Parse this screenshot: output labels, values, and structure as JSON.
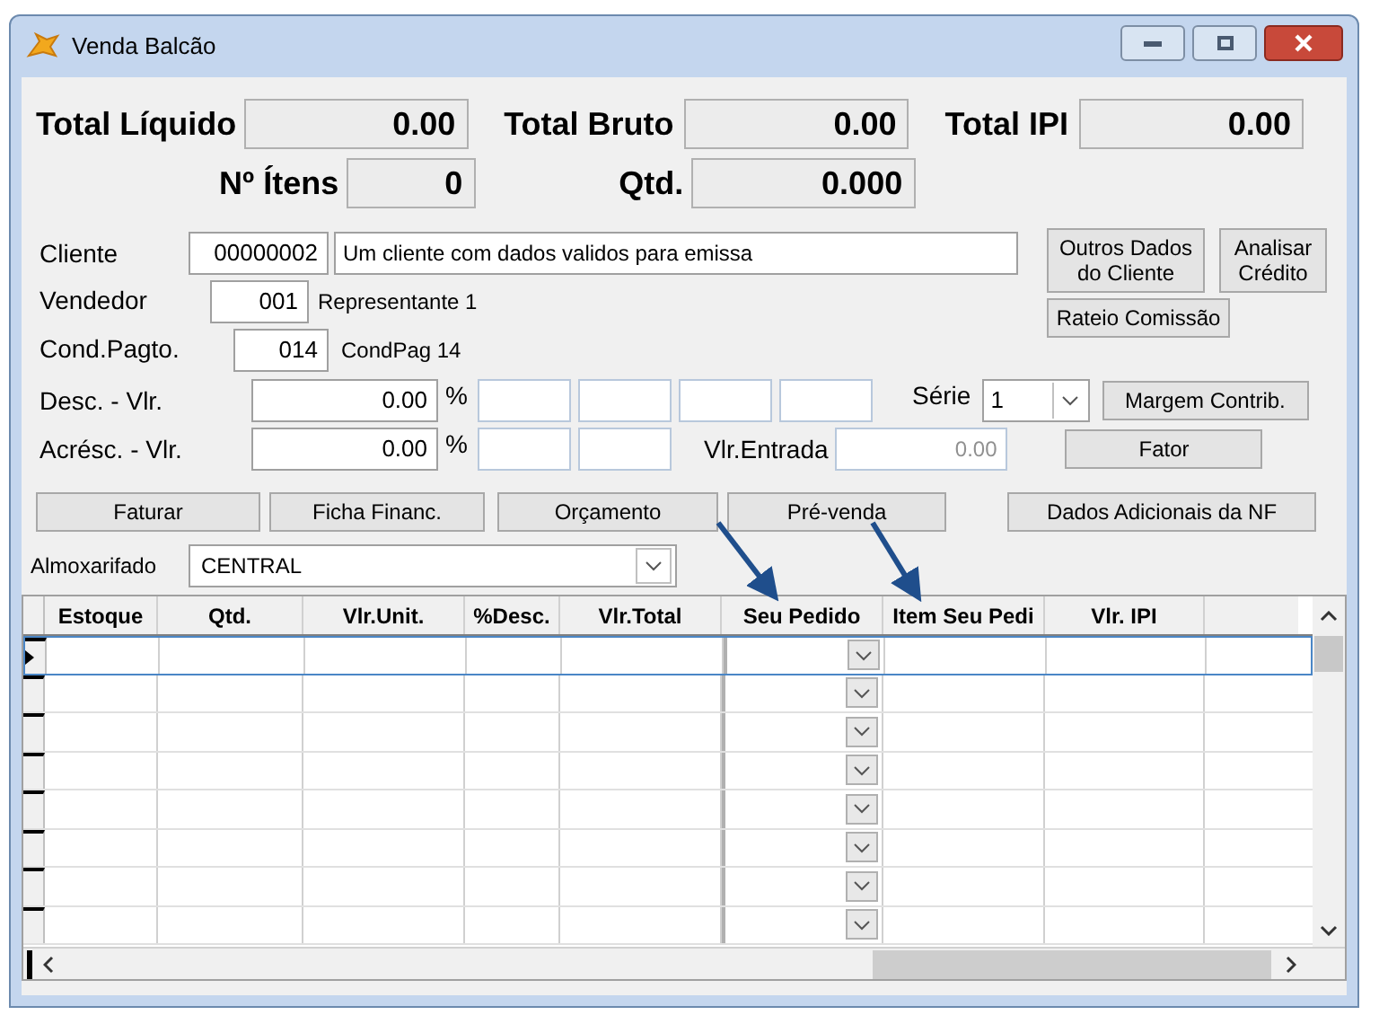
{
  "window": {
    "title": "Venda Balcão"
  },
  "totals": [
    {
      "label": "Total Líquido",
      "value": "0.00"
    },
    {
      "label": "Total Bruto",
      "value": "0.00"
    },
    {
      "label": "Total IPI",
      "value": "0.00"
    }
  ],
  "counts": [
    {
      "label": "Nº Ítens",
      "value": "0"
    },
    {
      "label": "Qtd.",
      "value": "0.000"
    }
  ],
  "cliente": {
    "label": "Cliente",
    "code": "00000002",
    "name": "Um cliente com dados validos para emissa"
  },
  "vendedor": {
    "label": "Vendedor",
    "code": "001",
    "name": "Representante 1"
  },
  "cond_pagto": {
    "label": "Cond.Pagto.",
    "code": "014",
    "name": "CondPag 14"
  },
  "side_buttons": [
    "Outros Dados do Cliente",
    "Analisar Crédito",
    "Rateio Comissão"
  ],
  "desconto": {
    "label": "Desc. - Vlr.",
    "value": "0.00",
    "percent": "%"
  },
  "acrescimo": {
    "label": "Acrésc. - Vlr.",
    "value": "0.00",
    "percent": "%"
  },
  "serie": {
    "label": "Série",
    "value": "1"
  },
  "margem_button": "Margem Contrib.",
  "entrada": {
    "label": "Vlr.Entrada",
    "placeholder": "0.00"
  },
  "fator_button": "Fator",
  "action_buttons": [
    "Faturar",
    "Ficha Financ.",
    "Orçamento",
    "Pré-venda",
    "Dados Adicionais da NF"
  ],
  "almoxarifado": {
    "label": "Almoxarifado",
    "value": "CENTRAL"
  },
  "grid": {
    "columns": [
      "Estoque",
      "Qtd.",
      "Vlr.Unit.",
      "%Desc.",
      "Vlr.Total",
      "Seu Pedido",
      "Item Seu Pedi",
      "Vlr. IPI"
    ],
    "rows": [
      {
        "selected": true
      },
      {
        "selected": false
      },
      {
        "selected": false
      },
      {
        "selected": false
      },
      {
        "selected": false
      },
      {
        "selected": false
      },
      {
        "selected": false
      },
      {
        "selected": false
      }
    ]
  }
}
